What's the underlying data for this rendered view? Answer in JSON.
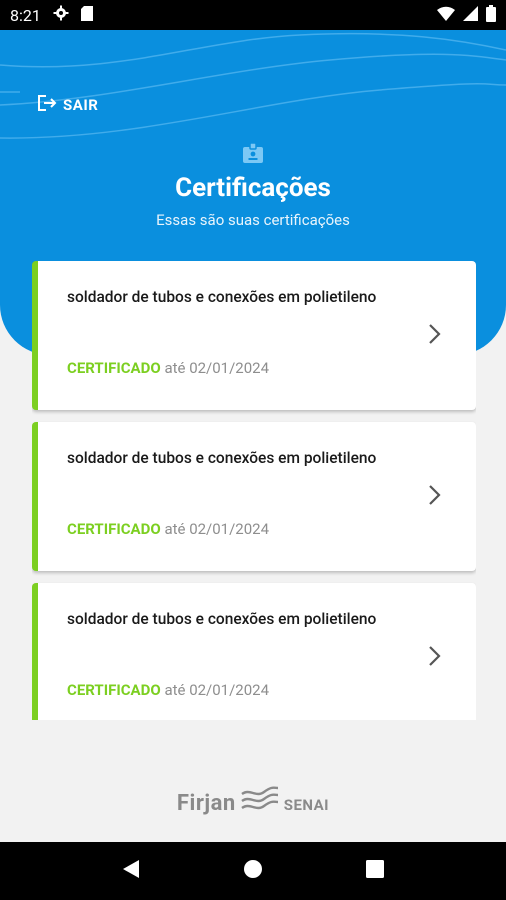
{
  "status_bar": {
    "time": "8:21",
    "icons": [
      "gear-icon",
      "sd-card-icon",
      "wifi-icon",
      "signal-icon",
      "battery-icon"
    ]
  },
  "header": {
    "logout_label": "SAIR",
    "title": "Certificações",
    "subtitle": "Essas são suas certificações",
    "background_color": "#0a8fde"
  },
  "certifications": [
    {
      "course": "soldador de tubos e conexões em polietileno",
      "status": "CERTIFICADO",
      "valid_until": "até 02/01/2024"
    },
    {
      "course": "soldador de tubos e conexões em polietileno",
      "status": "CERTIFICADO",
      "valid_until": "até 02/01/2024"
    },
    {
      "course": "soldador de tubos e conexões em polietileno",
      "status": "CERTIFICADO",
      "valid_until": "até 02/01/2024"
    }
  ],
  "colors": {
    "accent_green": "#7ccf21",
    "brand_blue": "#0a8fde"
  },
  "footer": {
    "brand_firjan": "Firjan",
    "brand_senai": "SENAI"
  },
  "nav_bar": {
    "buttons": [
      "back-icon",
      "home-icon",
      "recents-icon"
    ]
  }
}
